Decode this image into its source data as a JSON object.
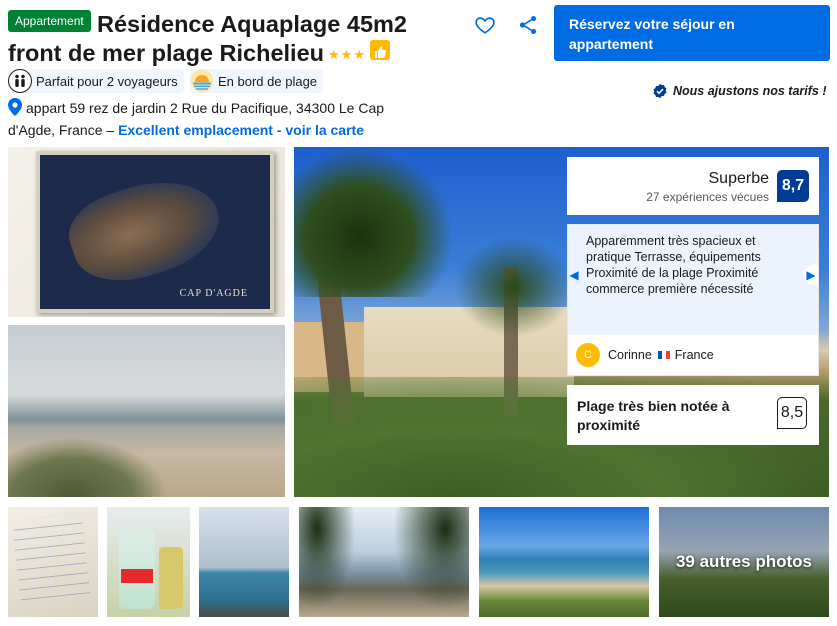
{
  "property": {
    "type_badge": "Appartement",
    "title": "Résidence Aquaplage 45m2 front de mer plage Richelieu",
    "stars": "★★★",
    "highlights": [
      {
        "label": "Parfait pour 2 voyageurs",
        "icon": "two-people-icon"
      },
      {
        "label": "En bord de plage",
        "icon": "beach-sunset-icon"
      }
    ],
    "address": "appart 59 rez de jardin 2 Rue du Pacifique, 34300 Le Cap d'Agde, France",
    "address_separator": " – ",
    "map_link": "Excellent emplacement - voir la carte",
    "price_match": "Nous ajustons nos tarifs !"
  },
  "actions": {
    "reserve_label": "Réservez votre séjour en appartement",
    "save_icon": "heart-icon",
    "share_icon": "share-icon"
  },
  "rating": {
    "label": "Superbe",
    "reviews": "27 expériences vécues",
    "score": "8,7"
  },
  "review": {
    "text": "Apparemment très spacieux et pratique Terrasse, équipements Proximité de la plage Proximité commerce première nécessité",
    "avatar_initial": "C",
    "reviewer": "Corinne",
    "country": "France"
  },
  "location": {
    "label": "Plage très bien notée à proximité",
    "score": "8,5"
  },
  "gallery": {
    "map_caption": "CAP D'AGDE",
    "more_photos": "39 autres photos"
  },
  "colors": {
    "brand_blue": "#006ce4",
    "score_blue": "#003b95",
    "badge_green": "#008234",
    "star_yellow": "#febb02"
  }
}
